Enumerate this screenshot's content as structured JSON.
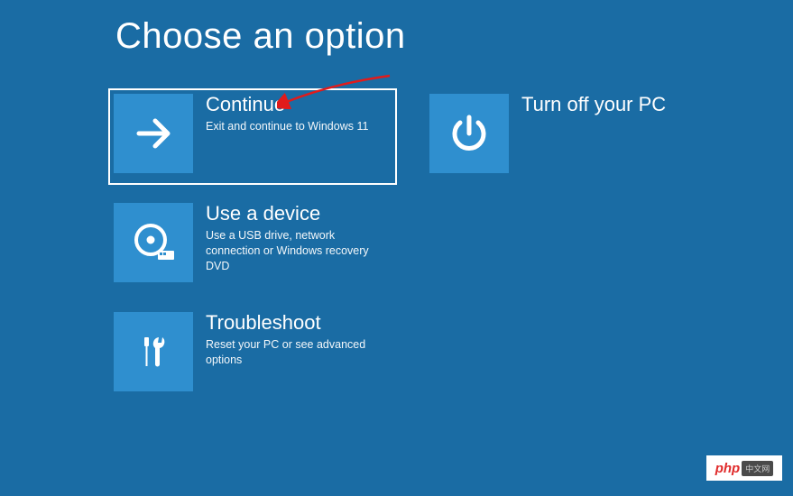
{
  "title": "Choose an option",
  "options": {
    "continue": {
      "title": "Continue",
      "desc": "Exit and continue to Windows 11"
    },
    "turn_off": {
      "title": "Turn off your PC"
    },
    "use_device": {
      "title": "Use a device",
      "desc": "Use a USB drive, network connection or Windows recovery DVD"
    },
    "troubleshoot": {
      "title": "Troubleshoot",
      "desc": "Reset your PC or see advanced options"
    }
  },
  "annotation": {
    "arrow_color": "#e11b1b"
  },
  "watermark": {
    "left": "php",
    "right": "中文网"
  }
}
